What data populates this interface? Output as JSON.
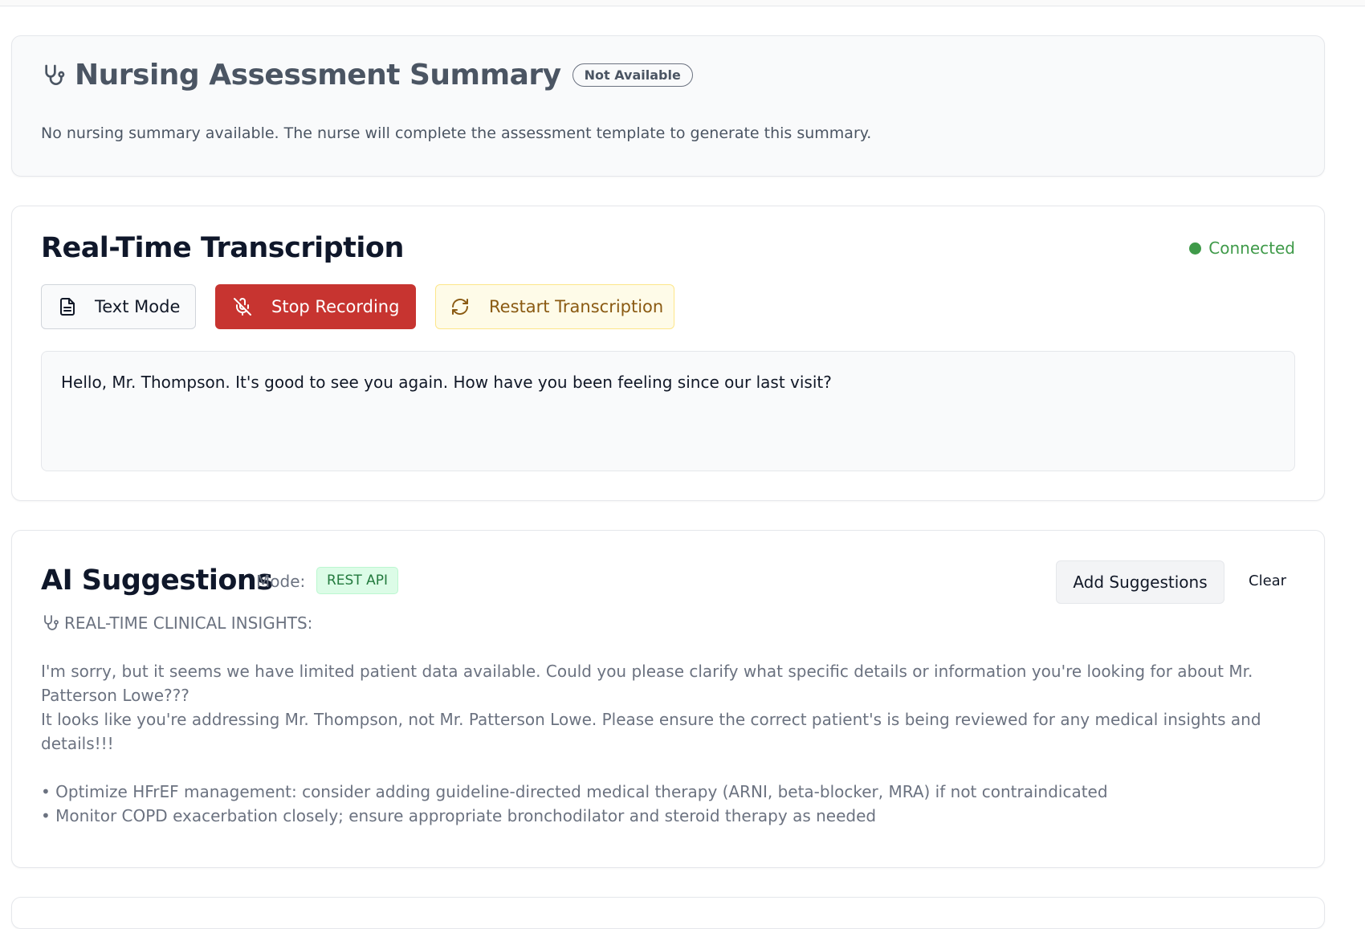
{
  "nursing": {
    "title": "Nursing Assessment Summary",
    "badge": "Not Available",
    "text": "No nursing summary available. The nurse will complete the assessment template to generate this summary."
  },
  "transcription": {
    "title": "Real-Time Transcription",
    "status": "Connected",
    "status_color": "#3f9a49",
    "buttons": {
      "text_mode": "Text Mode",
      "stop_recording": "Stop Recording",
      "restart": "Restart Transcription"
    },
    "transcript": "Hello, Mr. Thompson. It's good to see you again. How have you been feeling since our last visit?"
  },
  "ai": {
    "title": "AI Suggestions",
    "mode_label": "Mode:",
    "mode_value": "REST API",
    "add_button": "Add Suggestions",
    "clear_button": "Clear",
    "insights_heading": "REAL-TIME CLINICAL INSIGHTS:",
    "paragraph1": "I'm sorry, but it seems we have limited patient data available. Could you please clarify what specific details or information you're looking for about Mr. Patterson Lowe???",
    "paragraph2": "It looks like you're addressing Mr. Thompson, not Mr. Patterson Lowe. Please ensure the correct patient's is being reviewed for any medical insights and details!!!",
    "bullets": [
      "• Optimize HFrEF management: consider adding guideline-directed medical therapy (ARNI, beta-blocker, MRA) if not contraindicated",
      "• Monitor COPD exacerbation closely; ensure appropriate bronchodilator and steroid therapy as needed"
    ]
  },
  "colors": {
    "stop_button": "#c73430",
    "restart_bg": "#fefbe8",
    "mode_badge_bg": "#dcfce7"
  }
}
